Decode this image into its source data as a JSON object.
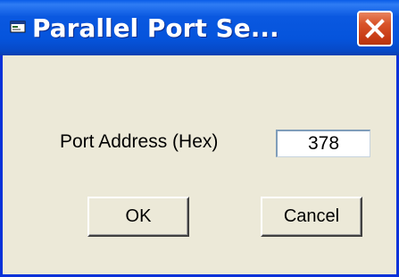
{
  "window": {
    "title": "Parallel Port Se...",
    "close_symbol": "✕"
  },
  "form": {
    "port_label": "Port Address (Hex)",
    "port_value": "378"
  },
  "buttons": {
    "ok_label": "OK",
    "cancel_label": "Cancel"
  },
  "colors": {
    "titlebar_blue": "#0554dc",
    "dialog_face": "#ece9d8",
    "close_red": "#d9542a"
  },
  "icons": {
    "app": "window-icon",
    "close": "close-icon"
  }
}
